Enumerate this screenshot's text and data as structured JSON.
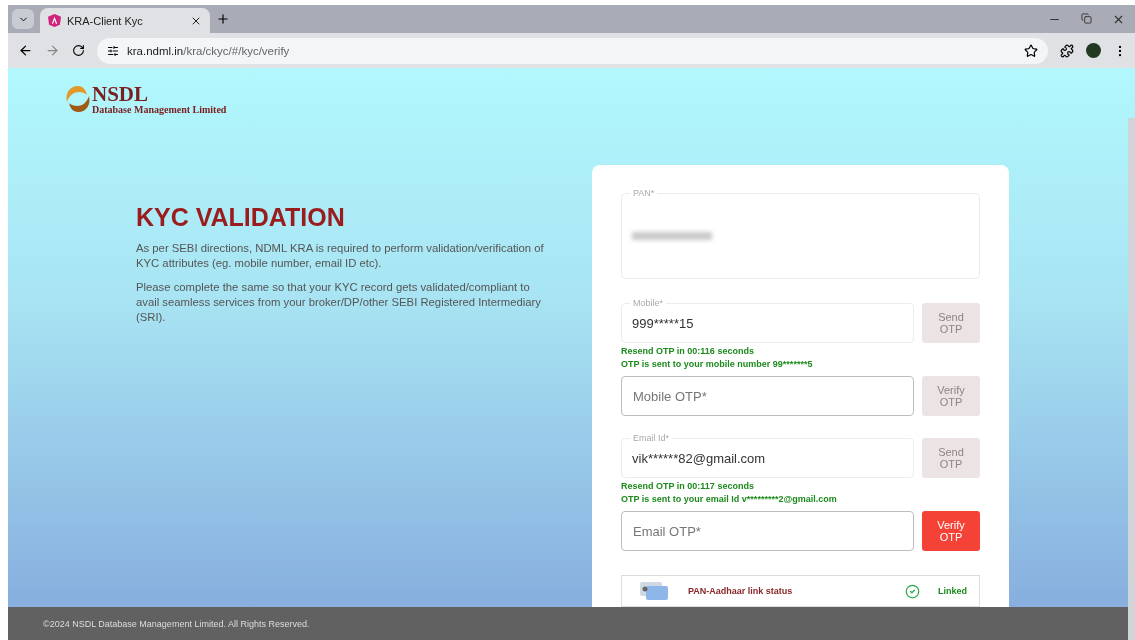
{
  "browser": {
    "tab": {
      "title": "KRA-Client Kyc",
      "selected": true
    },
    "url": {
      "host": "kra.ndml.in",
      "path": "/kra/ckyc/#/kyc/verify"
    }
  },
  "logo": {
    "name": "NSDL",
    "subtitle": "Database Management Limited"
  },
  "intro": {
    "heading": "KYC VALIDATION",
    "paragraphs": [
      "As per SEBI directions, NDML KRA is required to perform validation/verification of KYC attributes (eg. mobile number, email ID etc).",
      "Please complete the same so that your KYC record gets validated/compliant to avail seamless services from your broker/DP/other SEBI Registered Intermediary (SRI)."
    ]
  },
  "form": {
    "pan": {
      "label": "PAN*",
      "redacted": true
    },
    "contacts": [
      {
        "field": {
          "label": "Mobile*",
          "value": "999*****15"
        },
        "send_button": {
          "label": "Send OTP",
          "disabled": true
        },
        "messages": [
          "Resend OTP in 00:116 seconds",
          "OTP is sent to your mobile number 99*******5"
        ],
        "otp": {
          "placeholder": "Mobile OTP*"
        },
        "verify_button": {
          "label": "Verify OTP",
          "disabled": true
        }
      },
      {
        "field": {
          "label": "Email Id*",
          "value": "vik******82@gmail.com"
        },
        "send_button": {
          "label": "Send OTP",
          "disabled": true
        },
        "messages": [
          "Resend OTP in 00:117 seconds",
          "OTP is sent to your email Id v*********2@gmail.com"
        ],
        "otp": {
          "placeholder": "Email OTP*"
        },
        "verify_button": {
          "label": "Verify OTP",
          "disabled": false
        }
      }
    ],
    "link_status": {
      "label": "PAN-Aadhaar link status",
      "status": "Linked",
      "linked": true
    }
  },
  "footer": "©2024 NSDL Database Management Limited. All Rights Reserved."
}
